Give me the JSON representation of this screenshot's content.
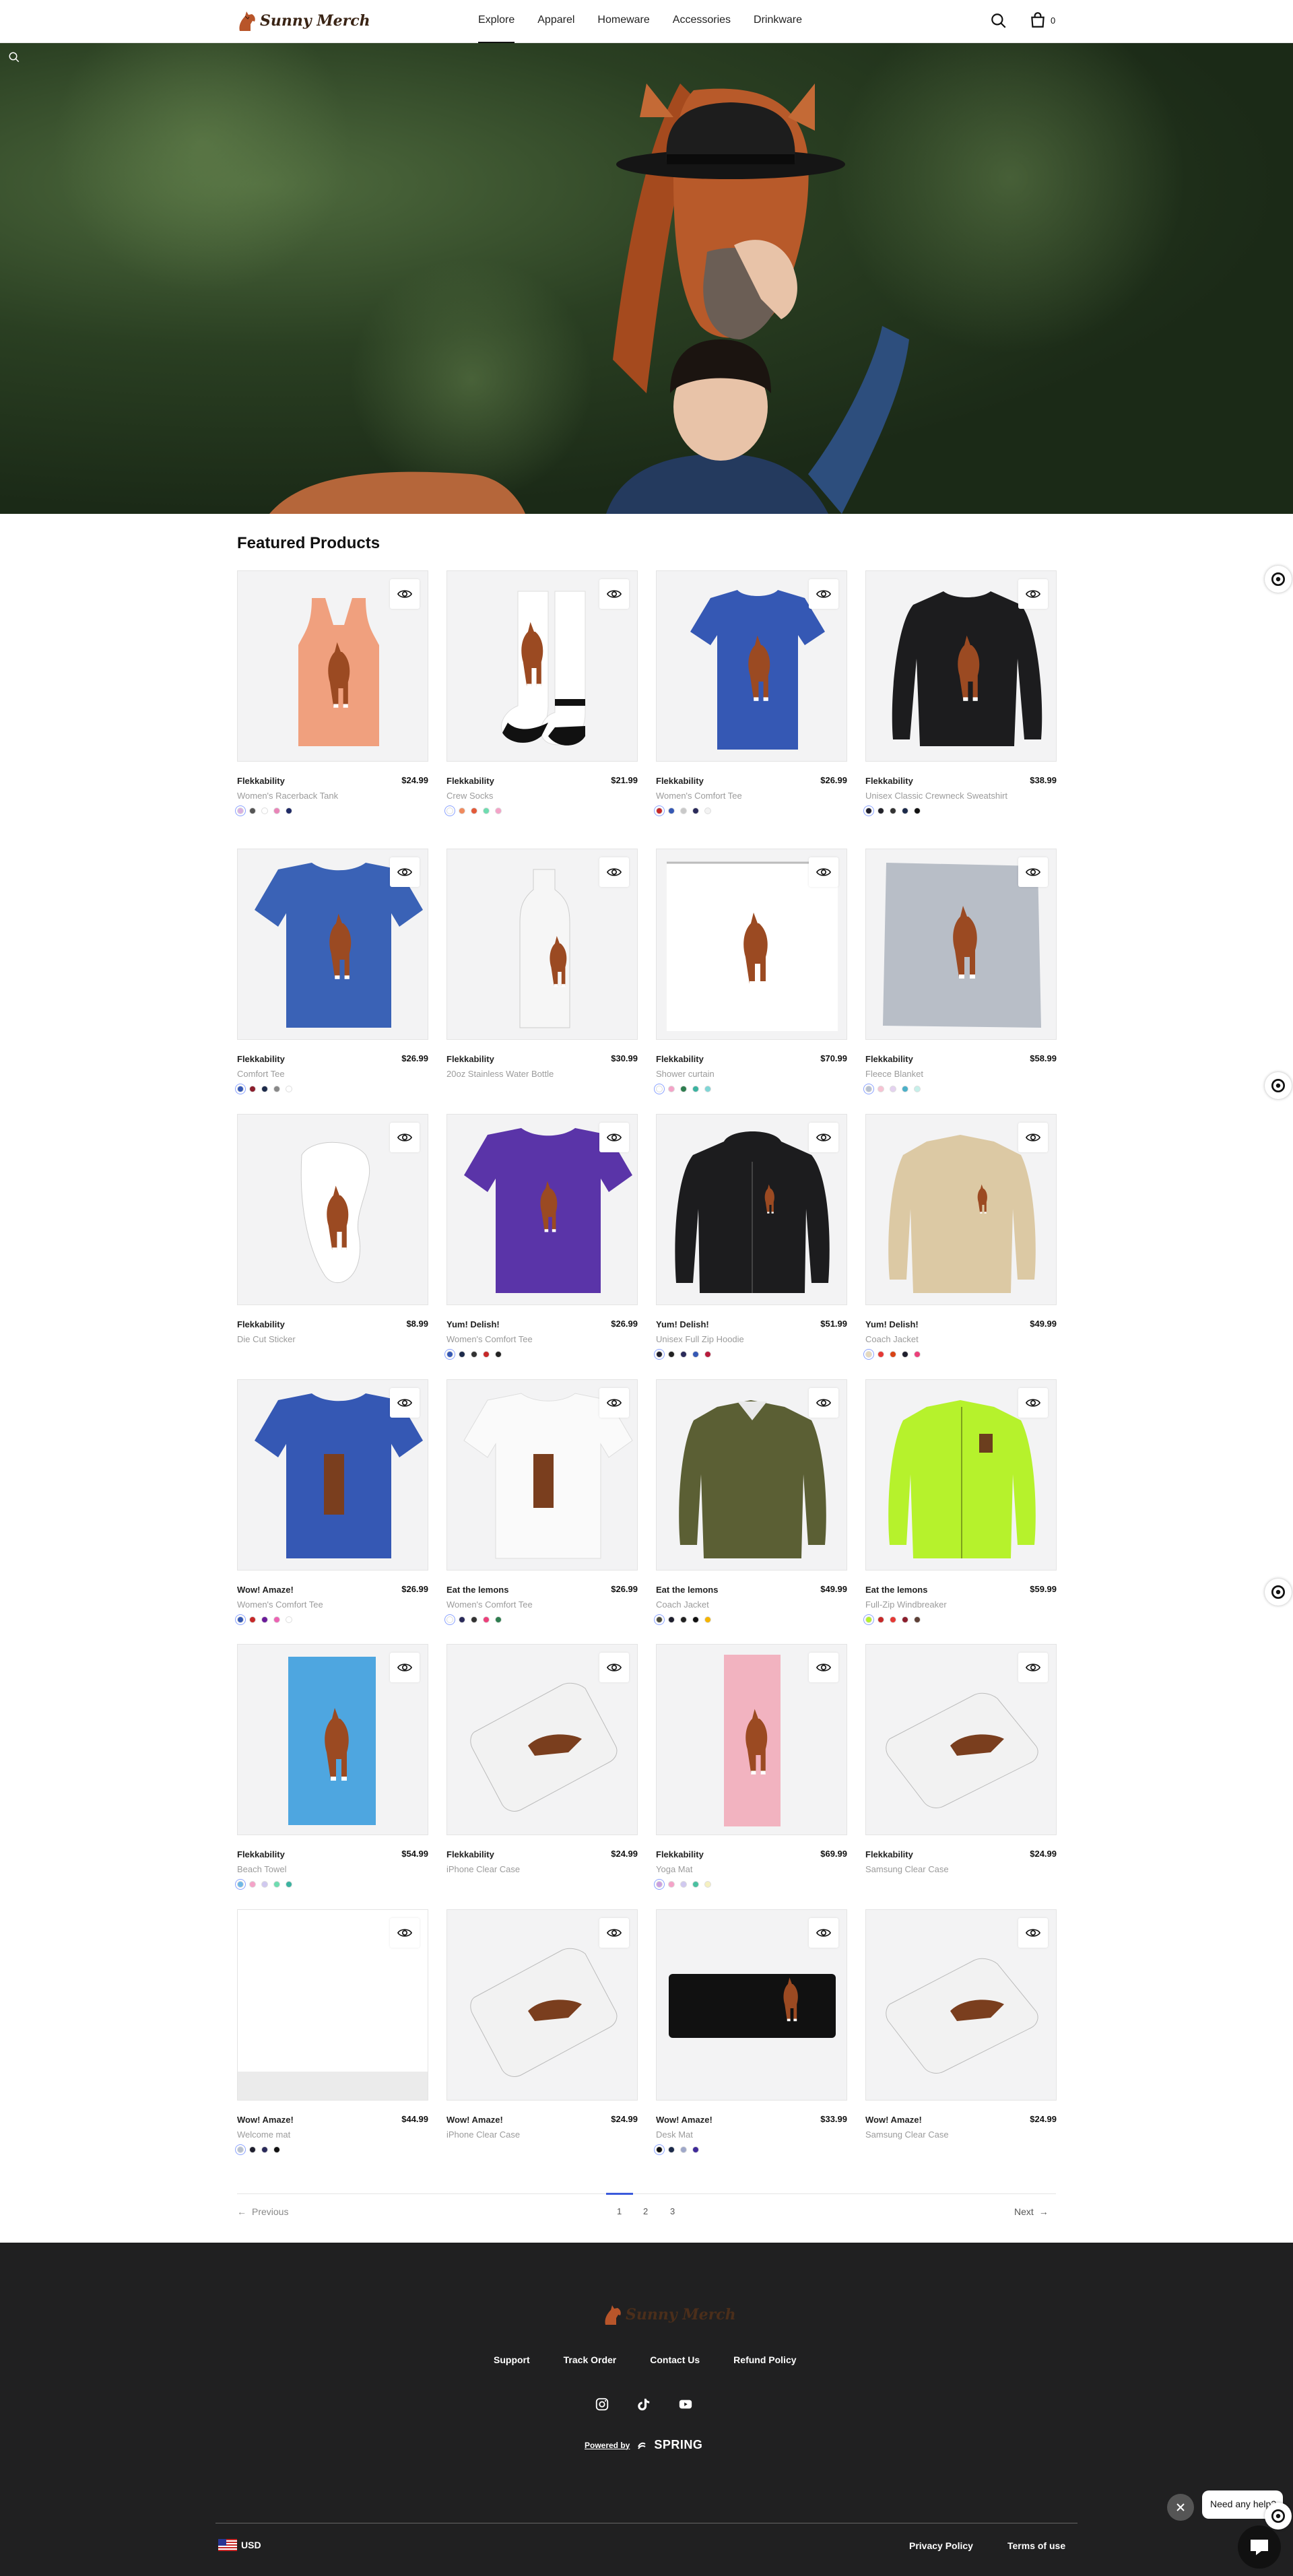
{
  "header": {
    "brand": "Sunny Merch",
    "nav": [
      "Explore",
      "Apparel",
      "Homeware",
      "Accessories",
      "Drinkware"
    ],
    "active_nav": "Explore",
    "cart_count": "0"
  },
  "main": {
    "section_title": "Featured Products"
  },
  "products": [
    {
      "brand": "Flekkability",
      "name": "Women's Racerback Tank",
      "price": "$24.99",
      "colors": [
        "#d9b0e0",
        "#555555",
        "#ffffff",
        "#e985b8",
        "#1f2a66"
      ],
      "img": "tank"
    },
    {
      "brand": "Flekkability",
      "name": "Crew Socks",
      "price": "$21.99",
      "colors": [
        "#ffffff",
        "#f08a5d",
        "#e35a39",
        "#6fdcb0",
        "#f4a3c8"
      ],
      "img": "socks"
    },
    {
      "brand": "Flekkability",
      "name": "Women's Comfort Tee",
      "price": "$26.99",
      "colors": [
        "#c62828",
        "#3558b4",
        "#c9c9c9",
        "#2a2a5a",
        "#f3f3f3"
      ],
      "img": "tee-blue"
    },
    {
      "brand": "Flekkability",
      "name": "Unisex Classic Crewneck Sweatshirt",
      "price": "$38.99",
      "colors": [
        "#1f1f2e",
        "#22222a",
        "#333333",
        "#1c2a4a",
        "#111111"
      ],
      "img": "sweat"
    },
    {
      "brand": "Flekkability",
      "name": "Comfort Tee",
      "price": "$26.99",
      "colors": [
        "#3558b4",
        "#8b1d2c",
        "#1c2a4a",
        "#888888",
        "#ffffff"
      ],
      "img": "tee-blue2"
    },
    {
      "brand": "Flekkability",
      "name": "20oz Stainless Water Bottle",
      "price": "$30.99",
      "colors": [],
      "img": "bottle"
    },
    {
      "brand": "Flekkability",
      "name": "Shower curtain",
      "price": "$70.99",
      "colors": [
        "#ffffff",
        "#f4a3c8",
        "#2e7d4f",
        "#3bb3a0",
        "#7fd6d6"
      ],
      "img": "curtain"
    },
    {
      "brand": "Flekkability",
      "name": "Fleece Blanket",
      "price": "$58.99",
      "colors": [
        "#b7c0cf",
        "#f7c3d3",
        "#e4d2f0",
        "#4bb0c8",
        "#c6f0ea"
      ],
      "img": "blanket"
    },
    {
      "brand": "Flekkability",
      "name": "Die Cut Sticker",
      "price": "$8.99",
      "colors": [],
      "img": "sticker"
    },
    {
      "brand": "Yum! Delish!",
      "name": "Women's Comfort Tee",
      "price": "$26.99",
      "colors": [
        "#3558b4",
        "#1c2a4a",
        "#333333",
        "#c62828",
        "#222222"
      ],
      "img": "tee-purple"
    },
    {
      "brand": "Yum! Delish!",
      "name": "Unisex Full Zip Hoodie",
      "price": "$51.99",
      "colors": [
        "#1f1f2e",
        "#222222",
        "#2a2a5a",
        "#3558b4",
        "#b71c3c"
      ],
      "img": "hoodie"
    },
    {
      "brand": "Yum! Delish!",
      "name": "Coach Jacket",
      "price": "$49.99",
      "colors": [
        "#e6d9bd",
        "#e53935",
        "#d84315",
        "#1f1f2e",
        "#ec407a"
      ],
      "img": "coach-tan"
    },
    {
      "brand": "Wow! Amaze!",
      "name": "Women's Comfort Tee",
      "price": "$26.99",
      "colors": [
        "#3558b4",
        "#c62828",
        "#6a1b9a",
        "#ec63b3",
        "#ffffff"
      ],
      "img": "tee-blue3"
    },
    {
      "brand": "Eat the lemons",
      "name": "Women's Comfort Tee",
      "price": "$26.99",
      "colors": [
        "#ffffff",
        "#2a2a5a",
        "#333333",
        "#ec407a",
        "#2e7d4f"
      ],
      "img": "tee-white"
    },
    {
      "brand": "Eat the lemons",
      "name": "Coach Jacket",
      "price": "$49.99",
      "colors": [
        "#4a4a3a",
        "#1f1f2e",
        "#222222",
        "#111111",
        "#f5b400"
      ],
      "img": "coach-olive"
    },
    {
      "brand": "Eat the lemons",
      "name": "Full-Zip Windbreaker",
      "price": "$59.99",
      "colors": [
        "#b6f22c",
        "#c62828",
        "#e53935",
        "#8b1d2c",
        "#5d4037"
      ],
      "img": "windbreaker"
    },
    {
      "brand": "Flekkability",
      "name": "Beach Towel",
      "price": "$54.99",
      "colors": [
        "#6fb7e6",
        "#f4a3c8",
        "#d0c9f0",
        "#6fdcb0",
        "#3bb3a0"
      ],
      "img": "towel"
    },
    {
      "brand": "Flekkability",
      "name": "iPhone Clear Case",
      "price": "$24.99",
      "colors": [],
      "img": "case"
    },
    {
      "brand": "Flekkability",
      "name": "Yoga Mat",
      "price": "$69.99",
      "colors": [
        "#c9a0e0",
        "#f4a3c8",
        "#d0c9f0",
        "#4bc0a0",
        "#f5f0c0"
      ],
      "img": "yoga"
    },
    {
      "brand": "Flekkability",
      "name": "Samsung Clear Case",
      "price": "$24.99",
      "colors": [],
      "img": "case2"
    },
    {
      "brand": "Wow! Amaze!",
      "name": "Welcome mat",
      "price": "$44.99",
      "colors": [
        "#b7c0cf",
        "#1f1f2e",
        "#2a2a5a",
        "#111111"
      ],
      "img": "mat"
    },
    {
      "brand": "Wow! Amaze!",
      "name": "iPhone Clear Case",
      "price": "$24.99",
      "colors": [],
      "img": "case"
    },
    {
      "brand": "Wow! Amaze!",
      "name": "Desk Mat",
      "price": "$33.99",
      "colors": [
        "#111111",
        "#1c2a4a",
        "#9fa8c9",
        "#3f2a99"
      ],
      "img": "deskmat"
    },
    {
      "brand": "Wow! Amaze!",
      "name": "Samsung Clear Case",
      "price": "$24.99",
      "colors": [],
      "img": "case2"
    }
  ],
  "pagination": {
    "prev": "Previous",
    "next": "Next",
    "pages": [
      "1",
      "2",
      "3"
    ],
    "current": "1"
  },
  "footer": {
    "brand": "Sunny Merch",
    "links": [
      "Support",
      "Track Order",
      "Contact Us",
      "Refund Policy"
    ],
    "social_icons": [
      "instagram-icon",
      "tiktok-icon",
      "youtube-icon"
    ],
    "powered_by": "Powered by",
    "powered_brand": "SPRING",
    "currency": "USD",
    "privacy": "Privacy Policy",
    "terms": "Terms of use"
  },
  "chat": {
    "bubble": "Need any help?"
  }
}
